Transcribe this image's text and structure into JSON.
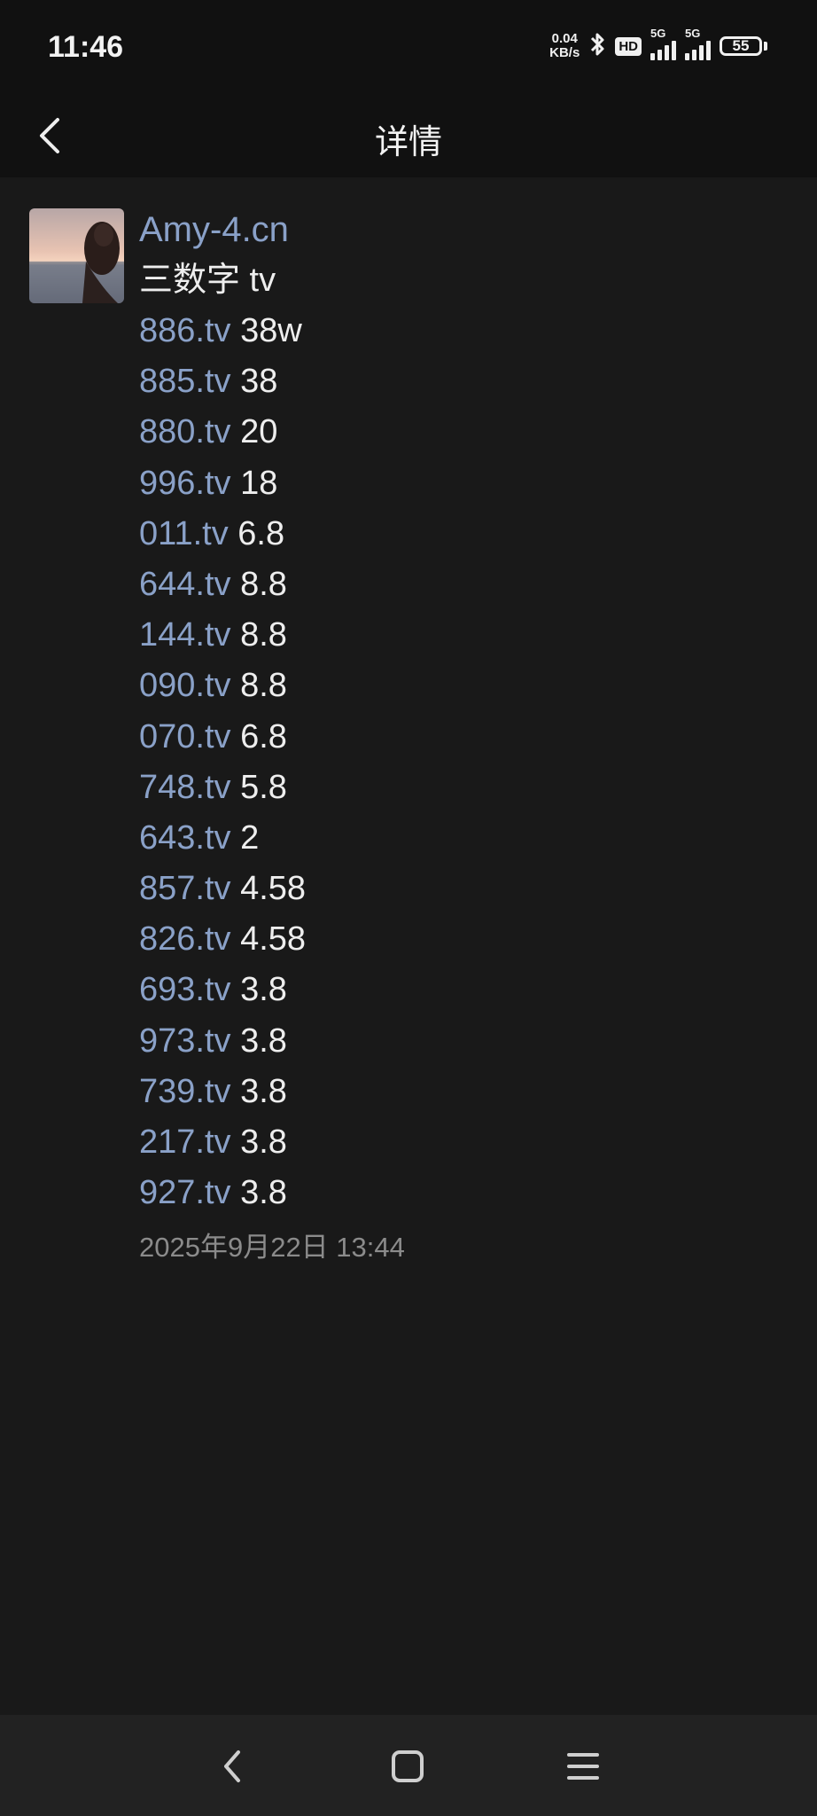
{
  "status": {
    "time": "11:46",
    "net_speed_value": "0.04",
    "net_speed_unit": "KB/s",
    "hd": "HD",
    "sim1": "5G",
    "sim2": "5G",
    "battery": "55"
  },
  "header": {
    "title": "详情"
  },
  "message": {
    "sender": "Amy-4.cn",
    "subject": "三数字 tv",
    "rows": [
      {
        "domain": "886.tv",
        "price": "38w"
      },
      {
        "domain": "885.tv",
        "price": "38"
      },
      {
        "domain": "880.tv",
        "price": "20"
      },
      {
        "domain": "996.tv",
        "price": "18"
      },
      {
        "domain": "011.tv",
        "price": "6.8"
      },
      {
        "domain": "644.tv",
        "price": "8.8"
      },
      {
        "domain": "144.tv",
        "price": "8.8"
      },
      {
        "domain": "090.tv",
        "price": "8.8"
      },
      {
        "domain": "070.tv",
        "price": "6.8"
      },
      {
        "domain": "748.tv",
        "price": "5.8"
      },
      {
        "domain": "643.tv",
        "price": "2"
      },
      {
        "domain": "857.tv",
        "price": "4.58"
      },
      {
        "domain": "826.tv",
        "price": "4.58"
      },
      {
        "domain": "693.tv",
        "price": "3.8"
      },
      {
        "domain": "973.tv",
        "price": "3.8"
      },
      {
        "domain": "739.tv",
        "price": "3.8"
      },
      {
        "domain": "217.tv",
        "price": "3.8"
      },
      {
        "domain": "927.tv",
        "price": "3.8"
      }
    ],
    "timestamp": "2025年9月22日 13:44"
  },
  "colors": {
    "background": "#191919",
    "bar": "#111111",
    "link": "#8aa1c8",
    "text": "#eeeeee",
    "muted": "#8b8b8b"
  },
  "icons": {
    "back": "chevron-left-icon",
    "nav_back": "nav-back-icon",
    "nav_home": "nav-home-icon",
    "nav_menu": "nav-menu-icon"
  }
}
